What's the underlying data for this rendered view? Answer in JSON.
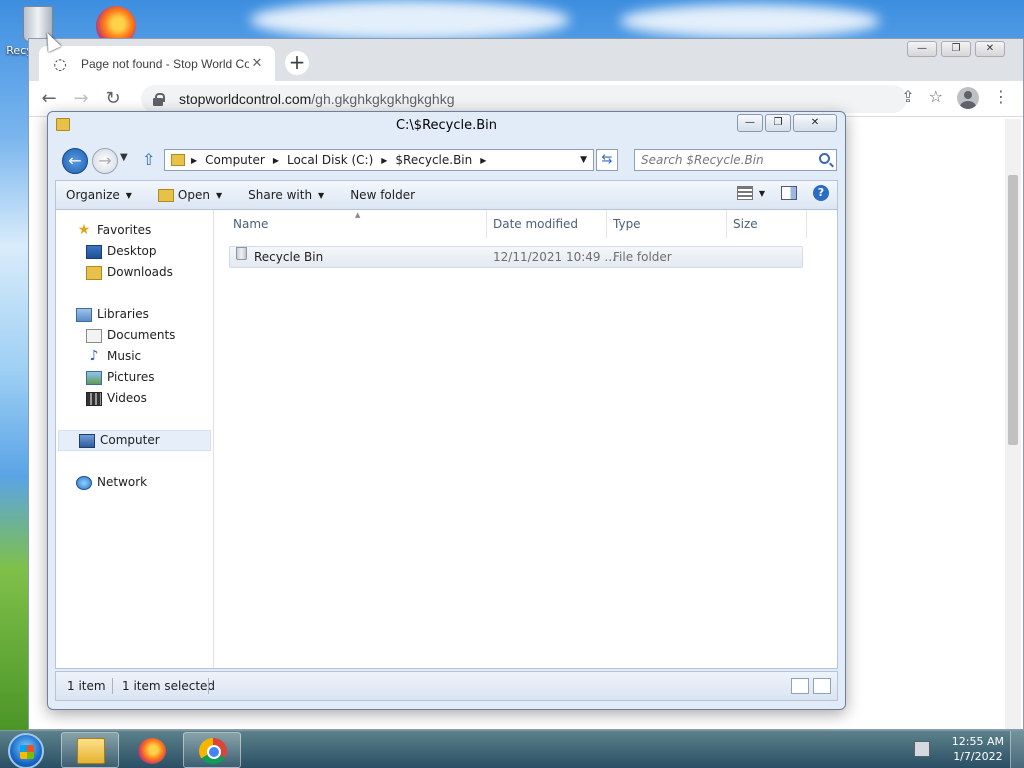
{
  "desktop": {
    "icons": [
      {
        "label": "Recycle Bin",
        "icon": "recycle-bin-icon"
      },
      {
        "label": "",
        "icon": "firefox-icon"
      }
    ]
  },
  "chrome": {
    "tab_title": "Page not found - Stop World Control",
    "tab_close": "✕",
    "new_tab": "+",
    "url_host": "stopworldcontrol.com",
    "url_path": "/gh.gkghkgkgkhgkghkg",
    "back": "←",
    "forward": "→",
    "reload": "↻",
    "share": "⇪",
    "bookmark": "☆",
    "menu": "⋮"
  },
  "explorer": {
    "title": "C:\\$Recycle.Bin",
    "breadcrumb": [
      "Computer",
      "Local Disk (C:)",
      "$Recycle.Bin"
    ],
    "search_placeholder": "Search $Recycle.Bin",
    "toolbar": {
      "organize": "Organize",
      "open": "Open",
      "share_with": "Share with",
      "new_folder": "New folder"
    },
    "nav": {
      "favorites": "Favorites",
      "desktop": "Desktop",
      "downloads": "Downloads",
      "libraries": "Libraries",
      "documents": "Documents",
      "music": "Music",
      "pictures": "Pictures",
      "videos": "Videos",
      "computer": "Computer",
      "network": "Network"
    },
    "columns": {
      "name": "Name",
      "date": "Date modified",
      "type": "Type",
      "size": "Size"
    },
    "files": [
      {
        "name": "Recycle Bin",
        "date": "12/11/2021 10:49 ...",
        "type": "File folder",
        "size": ""
      }
    ],
    "status": {
      "count": "1 item",
      "selected": "1 item selected"
    }
  },
  "taskbar": {
    "time": "12:55 AM",
    "date": "1/7/2022"
  }
}
